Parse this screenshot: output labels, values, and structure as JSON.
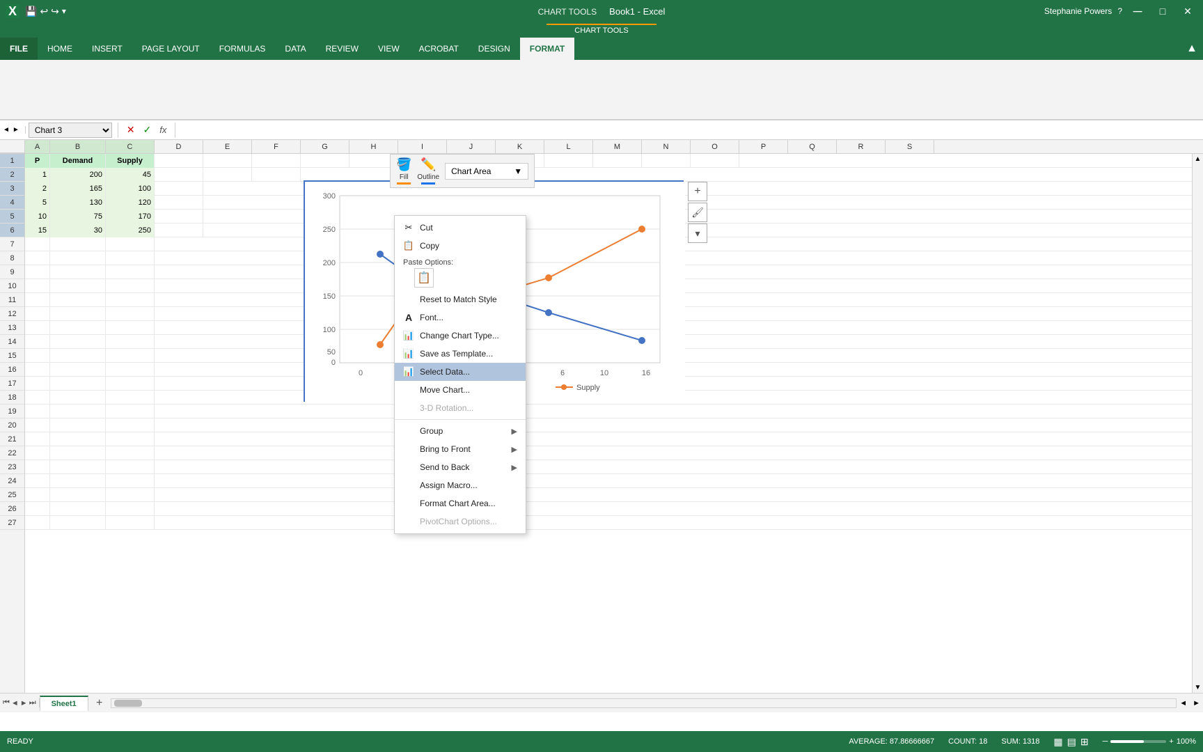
{
  "app": {
    "title": "Book1 - Excel",
    "chart_tools": "CHART TOOLS"
  },
  "title_bar": {
    "save_icon": "💾",
    "undo_icon": "↩",
    "redo_icon": "↪",
    "quick_access": "⚙",
    "title": "Book1 - Excel",
    "help_icon": "?",
    "min_icon": "—",
    "max_icon": "□",
    "close_icon": "✕",
    "user": "Stephanie Powers"
  },
  "ribbon": {
    "tabs": [
      "FILE",
      "HOME",
      "INSERT",
      "PAGE LAYOUT",
      "FORMULAS",
      "DATA",
      "REVIEW",
      "VIEW",
      "ACROBAT",
      "DESIGN",
      "FORMAT"
    ],
    "active_tab": "FORMAT"
  },
  "formula_bar": {
    "name_box": "Chart 3",
    "cancel_icon": "✕",
    "confirm_icon": "✓",
    "fx_label": "fx"
  },
  "columns": [
    "A",
    "B",
    "C",
    "D",
    "E",
    "F",
    "G",
    "H",
    "I",
    "J",
    "K",
    "L",
    "M",
    "N",
    "O",
    "P",
    "Q",
    "R",
    "S"
  ],
  "spreadsheet": {
    "rows": [
      {
        "row": 1,
        "cells": [
          "P",
          "Demand",
          "Supply",
          "",
          "",
          "",
          "",
          "",
          "",
          "",
          "",
          "",
          "",
          "",
          "",
          "",
          "",
          "",
          ""
        ]
      },
      {
        "row": 2,
        "cells": [
          "1",
          "200",
          "45",
          "",
          "",
          "",
          "",
          "",
          "",
          "",
          "",
          "",
          "",
          "",
          "",
          "",
          "",
          "",
          ""
        ]
      },
      {
        "row": 3,
        "cells": [
          "2",
          "165",
          "100",
          "",
          "",
          "",
          "",
          "",
          "",
          "",
          "",
          "",
          "",
          "",
          "",
          "",
          "",
          "",
          ""
        ]
      },
      {
        "row": 4,
        "cells": [
          "5",
          "130",
          "120",
          "",
          "",
          "",
          "",
          "",
          "",
          "",
          "",
          "",
          "",
          "",
          "",
          "",
          "",
          "",
          ""
        ]
      },
      {
        "row": 5,
        "cells": [
          "10",
          "75",
          "170",
          "",
          "",
          "",
          "",
          "",
          "",
          "",
          "",
          "",
          "",
          "",
          "",
          "",
          "",
          "",
          ""
        ]
      },
      {
        "row": 6,
        "cells": [
          "15",
          "30",
          "250",
          "",
          "",
          "",
          "",
          "",
          "",
          "",
          "",
          "",
          "",
          "",
          "",
          "",
          "",
          "",
          ""
        ]
      },
      {
        "row": 7,
        "cells": [
          "",
          "",
          "",
          "",
          "",
          "",
          "",
          "",
          "",
          "",
          "",
          "",
          "",
          "",
          "",
          "",
          "",
          "",
          ""
        ]
      },
      {
        "row": 8,
        "cells": [
          "",
          "",
          "",
          "",
          "",
          "",
          "",
          "",
          "",
          "",
          "",
          "",
          "",
          "",
          "",
          "",
          "",
          "",
          ""
        ]
      },
      {
        "row": 9,
        "cells": [
          "",
          "",
          "",
          "",
          "",
          "",
          "",
          "",
          "",
          "",
          "",
          "",
          "",
          "",
          "",
          "",
          "",
          "",
          ""
        ]
      },
      {
        "row": 10,
        "cells": [
          "",
          "",
          "",
          "",
          "",
          "",
          "",
          "",
          "",
          "",
          "",
          "",
          "",
          "",
          "",
          "",
          "",
          "",
          ""
        ]
      },
      {
        "row": 11,
        "cells": [
          "",
          "",
          "",
          "",
          "",
          "",
          "",
          "",
          "",
          "",
          "",
          "",
          "",
          "",
          "",
          "",
          "",
          "",
          ""
        ]
      },
      {
        "row": 12,
        "cells": [
          "",
          "",
          "",
          "",
          "",
          "",
          "",
          "",
          "",
          "",
          "",
          "",
          "",
          "",
          "",
          "",
          "",
          "",
          ""
        ]
      },
      {
        "row": 13,
        "cells": [
          "",
          "",
          "",
          "",
          "",
          "",
          "",
          "",
          "",
          "",
          "",
          "",
          "",
          "",
          "",
          "",
          "",
          "",
          ""
        ]
      },
      {
        "row": 14,
        "cells": [
          "",
          "",
          "",
          "",
          "",
          "",
          "",
          "",
          "",
          "",
          "",
          "",
          "",
          "",
          "",
          "",
          "",
          "",
          ""
        ]
      },
      {
        "row": 15,
        "cells": [
          "",
          "",
          "",
          "",
          "",
          "",
          "",
          "",
          "",
          "",
          "",
          "",
          "",
          "",
          "",
          "",
          "",
          "",
          ""
        ]
      },
      {
        "row": 16,
        "cells": [
          "",
          "",
          "",
          "",
          "",
          "",
          "",
          "",
          "",
          "",
          "",
          "",
          "",
          "",
          "",
          "",
          "",
          "",
          ""
        ]
      },
      {
        "row": 17,
        "cells": [
          "",
          "",
          "",
          "",
          "",
          "",
          "",
          "",
          "",
          "",
          "",
          "",
          "",
          "",
          "",
          "",
          "",
          "",
          ""
        ]
      },
      {
        "row": 18,
        "cells": [
          "",
          "",
          "",
          "",
          "",
          "",
          "",
          "",
          "",
          "",
          "",
          "",
          "",
          "",
          "",
          "",
          "",
          "",
          ""
        ]
      },
      {
        "row": 19,
        "cells": [
          "",
          "",
          "",
          "",
          "",
          "",
          "",
          "",
          "",
          "",
          "",
          "",
          "",
          "",
          "",
          "",
          "",
          "",
          ""
        ]
      },
      {
        "row": 20,
        "cells": [
          "",
          "",
          "",
          "",
          "",
          "",
          "",
          "",
          "",
          "",
          "",
          "",
          "",
          "",
          "",
          "",
          "",
          "",
          ""
        ]
      },
      {
        "row": 21,
        "cells": [
          "",
          "",
          "",
          "",
          "",
          "",
          "",
          "",
          "",
          "",
          "",
          "",
          "",
          "",
          "",
          "",
          "",
          "",
          ""
        ]
      },
      {
        "row": 22,
        "cells": [
          "",
          "",
          "",
          "",
          "",
          "",
          "",
          "",
          "",
          "",
          "",
          "",
          "",
          "",
          "",
          "",
          "",
          "",
          ""
        ]
      },
      {
        "row": 23,
        "cells": [
          "",
          "",
          "",
          "",
          "",
          "",
          "",
          "",
          "",
          "",
          "",
          "",
          "",
          "",
          "",
          "",
          "",
          "",
          ""
        ]
      },
      {
        "row": 24,
        "cells": [
          "",
          "",
          "",
          "",
          "",
          "",
          "",
          "",
          "",
          "",
          "",
          "",
          "",
          "",
          "",
          "",
          "",
          "",
          ""
        ]
      },
      {
        "row": 25,
        "cells": [
          "",
          "",
          "",
          "",
          "",
          "",
          "",
          "",
          "",
          "",
          "",
          "",
          "",
          "",
          "",
          "",
          "",
          "",
          ""
        ]
      },
      {
        "row": 26,
        "cells": [
          "",
          "",
          "",
          "",
          "",
          "",
          "",
          "",
          "",
          "",
          "",
          "",
          "",
          "",
          "",
          "",
          "",
          "",
          ""
        ]
      },
      {
        "row": 27,
        "cells": [
          "",
          "",
          "",
          "",
          "",
          "",
          "",
          "",
          "",
          "",
          "",
          "",
          "",
          "",
          "",
          "",
          "",
          "",
          ""
        ]
      }
    ]
  },
  "chart": {
    "title": "Chart Area",
    "supply_label": "Supply",
    "format_bar": {
      "fill_label": "Fill",
      "outline_label": "Outline",
      "area_dropdown": "Chart Area",
      "dropdown_arrow": "▼"
    },
    "side_buttons": [
      "+",
      "✏",
      "▾"
    ]
  },
  "context_menu": {
    "items": [
      {
        "id": "cut",
        "icon": "✂",
        "label": "Cut",
        "type": "normal"
      },
      {
        "id": "copy",
        "icon": "📋",
        "label": "Copy",
        "type": "normal"
      },
      {
        "id": "paste-options",
        "label": "Paste Options:",
        "type": "section"
      },
      {
        "id": "paste-icon",
        "icon": "📋",
        "label": "",
        "type": "paste-icon"
      },
      {
        "id": "reset-match",
        "icon": "",
        "label": "Reset to Match Style",
        "type": "normal"
      },
      {
        "id": "font",
        "icon": "A",
        "label": "Font...",
        "type": "normal"
      },
      {
        "id": "change-chart",
        "icon": "📊",
        "label": "Change Chart Type...",
        "type": "normal"
      },
      {
        "id": "save-template",
        "icon": "📊",
        "label": "Save as Template...",
        "type": "normal"
      },
      {
        "id": "select-data",
        "icon": "📊",
        "label": "Select Data...",
        "type": "highlighted"
      },
      {
        "id": "move-chart",
        "icon": "",
        "label": "Move Chart...",
        "type": "normal"
      },
      {
        "id": "3d-rotation",
        "icon": "",
        "label": "3-D Rotation...",
        "type": "disabled"
      },
      {
        "id": "divider1",
        "type": "divider"
      },
      {
        "id": "group",
        "icon": "",
        "label": "Group",
        "type": "submenu"
      },
      {
        "id": "bring-to-front",
        "icon": "",
        "label": "Bring to Front",
        "type": "submenu"
      },
      {
        "id": "send-to-back",
        "icon": "",
        "label": "Send to Back",
        "type": "submenu"
      },
      {
        "id": "assign-macro",
        "icon": "",
        "label": "Assign Macro...",
        "type": "normal"
      },
      {
        "id": "format-chart",
        "icon": "",
        "label": "Format Chart Area...",
        "type": "normal"
      },
      {
        "id": "pivotchart",
        "icon": "",
        "label": "PivotChart Options...",
        "type": "disabled"
      }
    ]
  },
  "sheet_tabs": {
    "tabs": [
      "Sheet1"
    ],
    "active": "Sheet1",
    "add_btn": "+"
  },
  "status_bar": {
    "ready": "READY",
    "average": "AVERAGE: 87.86666667",
    "count": "COUNT: 18",
    "sum": "SUM: 1318",
    "zoom": "100%"
  }
}
